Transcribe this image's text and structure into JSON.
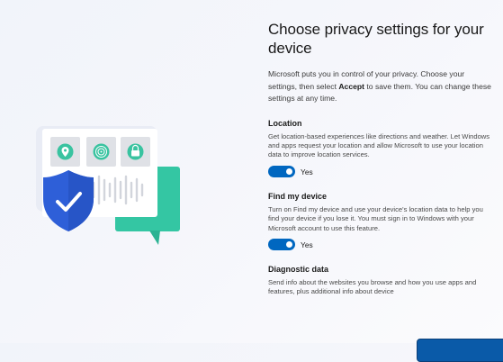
{
  "page": {
    "title": "Choose privacy settings for your device",
    "intro": {
      "before": "Microsoft puts you in control of your privacy. Choose your settings, then select ",
      "bold": "Accept",
      "after": " to save them. You can change these settings at any time."
    }
  },
  "settings": [
    {
      "title": "Location",
      "description": "Get location-based experiences like directions and weather. Let Windows and apps request your location and allow Microsoft to use your location data to improve location services.",
      "toggle_state": "Yes"
    },
    {
      "title": "Find my device",
      "description": "Turn on Find my device and use your device's location data to help you find your device if you lose it. You must sign in to Windows with your Microsoft account to use this feature.",
      "toggle_state": "Yes"
    },
    {
      "title": "Diagnostic data",
      "description": "Send info about the websites you browse and how you use apps and features, plus additional info about device"
    }
  ],
  "colors": {
    "accent": "#0067c0",
    "shield": "#2e5fd8",
    "bubble": "#33c5a2"
  },
  "illustration": {
    "icons": [
      "location-pin-icon",
      "fingerprint-icon",
      "lock-icon",
      "shield-check-icon",
      "sound-wave-icon",
      "chat-bubble-icon"
    ]
  }
}
